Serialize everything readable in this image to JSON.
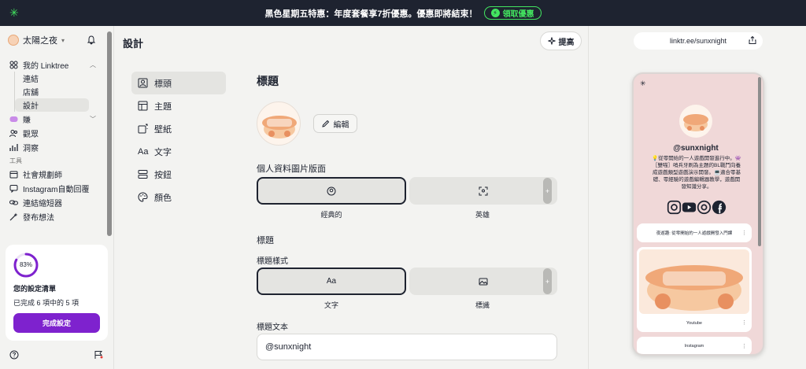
{
  "banner": {
    "text": "黑色星期五特惠：年度套餐享7折優惠。優惠即將結束！",
    "cta_label": "領取優惠"
  },
  "sidebar": {
    "account_name": "太陽之夜",
    "groups": [
      {
        "label": "我的 Linktree",
        "icon": "tree-icon",
        "expanded": true,
        "items": [
          {
            "label": "連結"
          },
          {
            "label": "店舖"
          },
          {
            "label": "設計",
            "active": true
          }
        ]
      },
      {
        "label": "賺",
        "icon": "coin-icon"
      },
      {
        "label": "觀眾",
        "icon": "audience-icon"
      },
      {
        "label": "洞察",
        "icon": "bar-chart-icon"
      }
    ],
    "tools_label": "工具",
    "tools": [
      {
        "label": "社會規劃師",
        "icon": "calendar-icon"
      },
      {
        "label": "Instagram自動回覆",
        "icon": "chat-icon"
      },
      {
        "label": "連結縮短器",
        "icon": "link-icon"
      },
      {
        "label": "發布想法",
        "icon": "wand-icon"
      }
    ],
    "setup": {
      "progress_label": "83%",
      "progress": 0.83,
      "title": "您的設定清單",
      "subtitle": "已完成 6 項中的 5 項",
      "button_label": "完成設定"
    }
  },
  "main": {
    "page_title": "設計",
    "enhance_label": "提高",
    "submenu": [
      {
        "label": "標頭",
        "icon": "header-icon",
        "active": true
      },
      {
        "label": "主題",
        "icon": "theme-icon"
      },
      {
        "label": "壁紙",
        "icon": "wallpaper-icon"
      },
      {
        "label": "文字",
        "icon": "text-icon"
      },
      {
        "label": "按鈕",
        "icon": "button-icon"
      },
      {
        "label": "顏色",
        "icon": "palette-icon"
      }
    ],
    "header_section_title": "標題",
    "edit_label": "編輯",
    "profile_layout_label": "個人資料圖片版面",
    "layout_options": [
      {
        "label": "經典的",
        "selected": true
      },
      {
        "label": "英雄",
        "selected": false
      }
    ],
    "title_section_label": "標題",
    "title_style_label": "標題樣式",
    "title_style_options": [
      {
        "label": "文字",
        "selected": true
      },
      {
        "label": "標識",
        "selected": false
      }
    ],
    "title_text_label": "標題文本",
    "title_text_value": "@sunxnight",
    "plus_glyph": "+"
  },
  "preview": {
    "url": "linktr.ee/sunxnight",
    "handle": "@sunxnight",
    "bio": "💡從零開始的一人遊戲開發進行中。👾［雙喵］哨兵牙刷為主題的BL戰鬥向養成遊戲類型遊戲演示開發。💻適合零基礎、零經驗的遊戲編輯器教學，遊戲開發知識分享。",
    "link_1": "夜遊趣: 從零開始的一人遊戲開發入門課",
    "link_2": "Youtube",
    "link_3": "Instagram",
    "dots_glyph": "⋮"
  },
  "colors": {
    "accent_purple": "#7e22ce",
    "banner_bg": "#1e2330",
    "banner_green": "#43e660",
    "phone_bg": "#f0d8d8"
  }
}
